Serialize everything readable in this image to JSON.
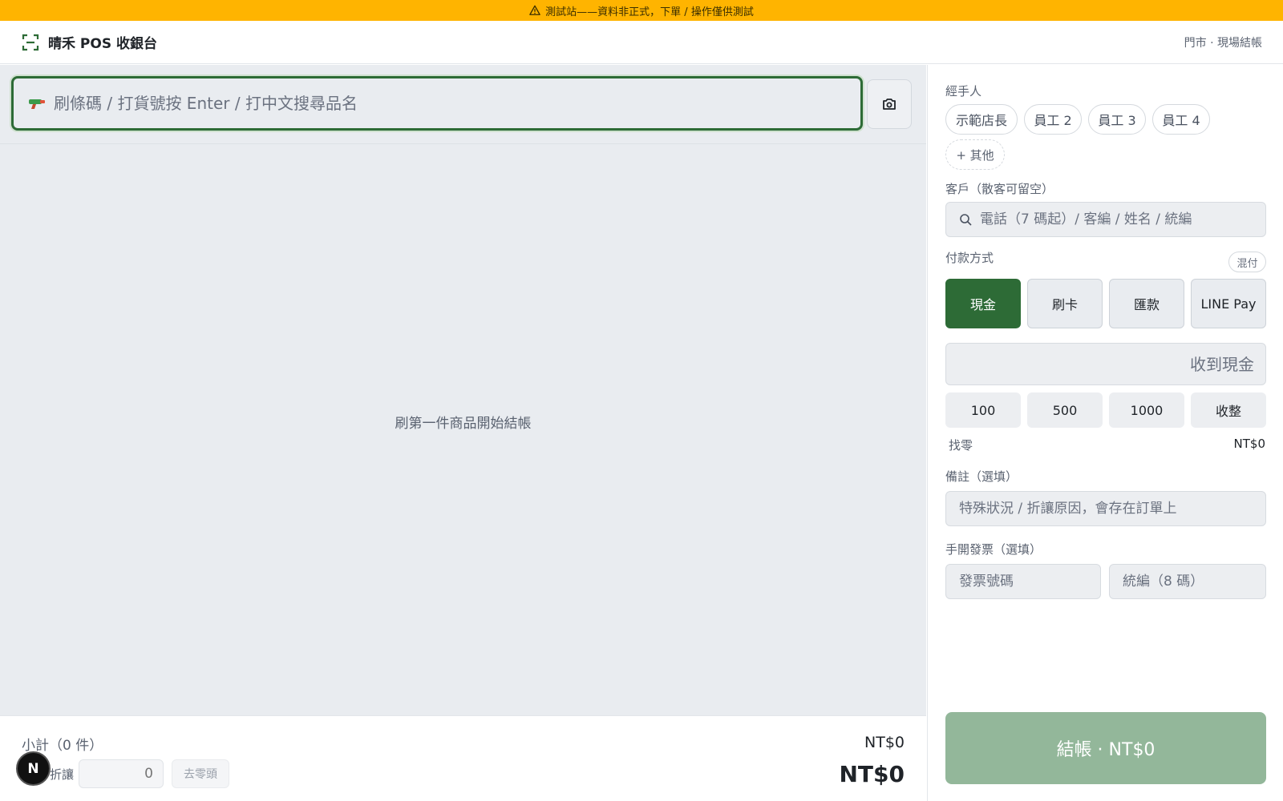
{
  "banner": {
    "text": "測試站——資料非正式，下單 / 操作僅供測試",
    "icon": "warning-triangle-icon"
  },
  "header": {
    "brand": "晴禾 POS 收銀台",
    "store_mode": "門市 · 現場結帳"
  },
  "scan": {
    "placeholder": "刷條碼 / 打貨號按 Enter / 打中文搜尋品名",
    "value": ""
  },
  "cart": {
    "empty_message": "刷第一件商品開始結帳"
  },
  "summary": {
    "subtotal_label": "小計（0 件）",
    "subtotal_value": "NT$0",
    "discount_label": "折讓",
    "discount_value": "0",
    "round_label": "去零頭",
    "total_value": "NT$0"
  },
  "dev_badge": "N",
  "panel": {
    "handler_label": "經手人",
    "handlers": [
      "示範店長",
      "員工 2",
      "員工 3",
      "員工 4"
    ],
    "handler_other": "+ 其他",
    "customer_label": "客戶（散客可留空）",
    "customer_placeholder": "電話（7 碼起）/ 客編 / 姓名 / 統編",
    "payment_label": "付款方式",
    "mixed_label": "混付",
    "payment_methods": [
      "現金",
      "刷卡",
      "匯款",
      "LINE Pay"
    ],
    "payment_selected": "現金",
    "cash_placeholder": "收到現金",
    "quick_amounts": [
      "100",
      "500",
      "1000",
      "收整"
    ],
    "change_label": "找零",
    "change_value": "NT$0",
    "note_label": "備註（選填）",
    "note_placeholder": "特殊狀況 / 折讓原因，會存在訂單上",
    "invoice_label": "手開發票（選填）",
    "invoice_number_placeholder": "發票號碼",
    "invoice_tax_placeholder": "統編（8 碼）",
    "checkout_label": "結帳 · NT$0"
  },
  "colors": {
    "accent": "#2d6b36",
    "banner": "#ffb400",
    "checkout_disabled": "#93b79a"
  }
}
